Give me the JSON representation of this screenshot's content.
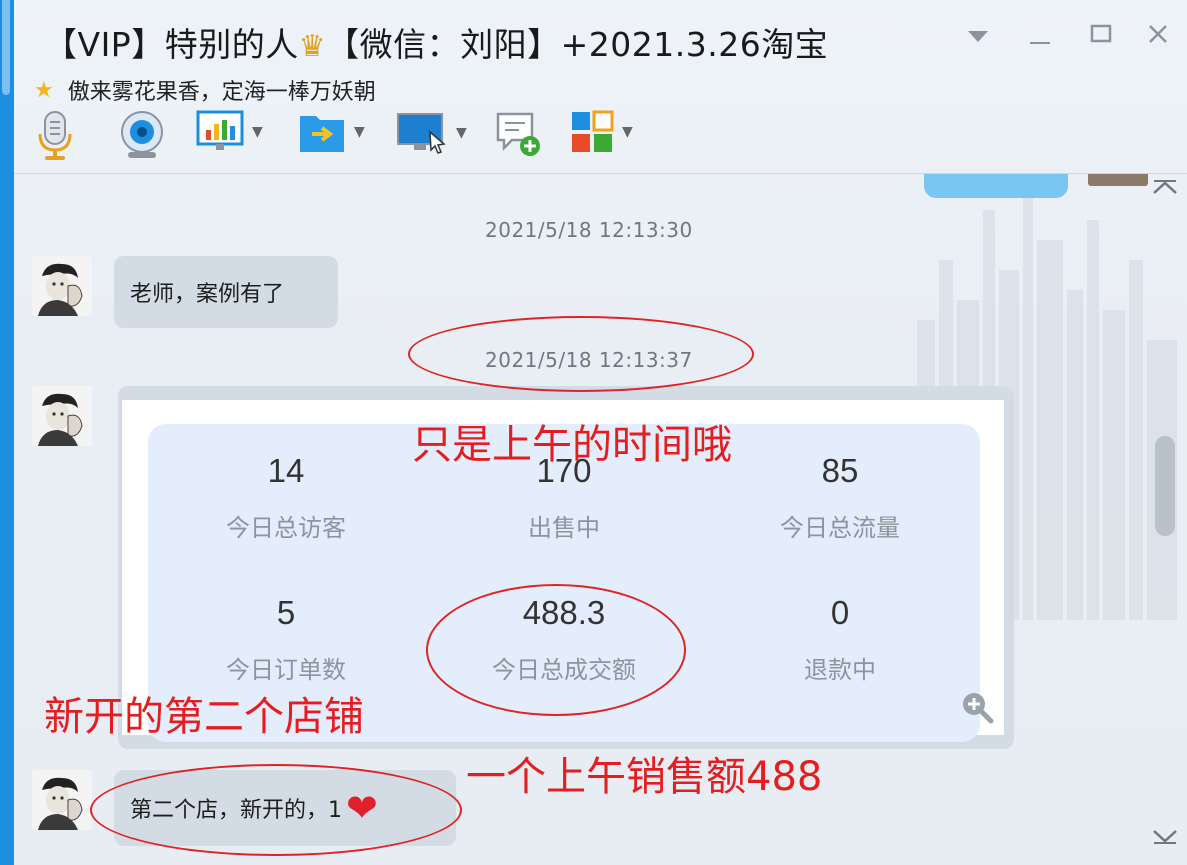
{
  "window": {
    "title_prefix": "【VIP】特别的人",
    "title_suffix": "【微信：刘阳】+2021.3.26淘宝",
    "signature": "傲来雾花果香，定海一棒万妖朝",
    "controls": [
      "dropdown",
      "minimize",
      "maximize",
      "close"
    ]
  },
  "toolbar": {
    "items": [
      {
        "name": "voice-call",
        "icon": "microphone-icon"
      },
      {
        "name": "video-call",
        "icon": "webcam-icon"
      },
      {
        "name": "screen-share",
        "icon": "presentation-icon"
      },
      {
        "name": "send-file",
        "icon": "folder-send-icon"
      },
      {
        "name": "remote-desktop",
        "icon": "remote-screen-icon"
      },
      {
        "name": "new-chat",
        "icon": "chat-add-icon"
      },
      {
        "name": "apps",
        "icon": "apps-grid-icon"
      }
    ]
  },
  "chat": {
    "timestamp1": "2021/5/18 12:13:30",
    "message1": "老师，案例有了",
    "timestamp2": "2021/5/18 12:13:37",
    "stats": [
      {
        "value": "14",
        "label": "今日总访客"
      },
      {
        "value": "170",
        "label": "出售中"
      },
      {
        "value": "85",
        "label": "今日总流量"
      },
      {
        "value": "5",
        "label": "今日订单数"
      },
      {
        "value": "488.3",
        "label": "今日总成交额"
      },
      {
        "value": "0",
        "label": "退款中"
      }
    ],
    "message3": "第二个店，新开的，1",
    "message3_emoji": "❤"
  },
  "annotations": {
    "time_note": "只是上午的时间哦",
    "shop_note": "新开的第二个店铺",
    "sales_note": "一个上午销售额488"
  },
  "colors": {
    "annotation_red": "#e41e1e",
    "bubble_gray": "#d3dbe4",
    "card_blue": "#e4edfc",
    "accent_blue": "#1e8fe0"
  }
}
